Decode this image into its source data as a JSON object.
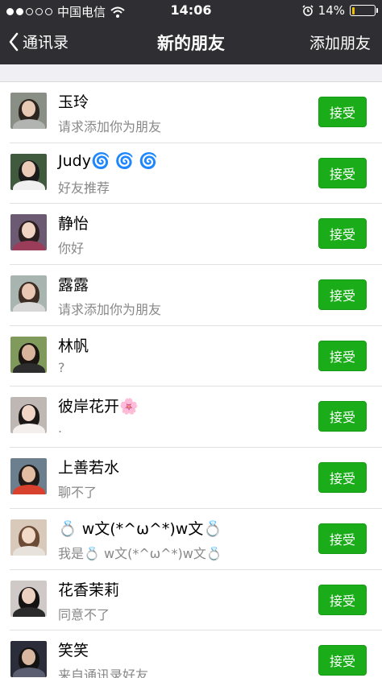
{
  "status_bar": {
    "carrier": "中国电信",
    "time": "14:06",
    "battery": "14%",
    "battery_level": 0.14,
    "signal_strength": 2,
    "signal_slots": 5,
    "battery_color": "#f2c200"
  },
  "nav": {
    "back_label": "通讯录",
    "title": "新的朋友",
    "right_action": "添加朋友"
  },
  "accent_color": "#1aad19",
  "requests": [
    {
      "name": "玉玲",
      "message": "请求添加你为朋友",
      "button": "接受",
      "avatar_bg": "#8a8f86",
      "avatar_hair": "#2b241f",
      "avatar_face": "#e8c9b4",
      "avatar_body": "#b1b4b0"
    },
    {
      "name": "Judy🌀 🌀 🌀",
      "message": "好友推荐",
      "button": "接受",
      "avatar_bg": "#3f5a3c",
      "avatar_hair": "#1b1b1b",
      "avatar_face": "#eacbb8",
      "avatar_body": "#f0f0f0"
    },
    {
      "name": "静怡",
      "message": "你好",
      "button": "接受",
      "avatar_bg": "#6b5a71",
      "avatar_hair": "#2a1e1e",
      "avatar_face": "#f0d3c3",
      "avatar_body": "#9a3d5b"
    },
    {
      "name": "露露",
      "message": "请求添加你为朋友",
      "button": "接受",
      "avatar_bg": "#a8b4b0",
      "avatar_hair": "#3c2c24",
      "avatar_face": "#e9c7b2",
      "avatar_body": "#d7d7d7"
    },
    {
      "name": "林帆",
      "message": "?",
      "button": "接受",
      "avatar_bg": "#7f9a5a",
      "avatar_hair": "#1b1612",
      "avatar_face": "#d9b49c",
      "avatar_body": "#2d2d2d"
    },
    {
      "name": "彼岸花开🌸",
      "message": ".",
      "button": "接受",
      "avatar_bg": "#bfb7b3",
      "avatar_hair": "#1d1818",
      "avatar_face": "#f1d5c6",
      "avatar_body": "#f2efed"
    },
    {
      "name": "上善若水",
      "message": "聊不了",
      "button": "接受",
      "avatar_bg": "#6b7f8f",
      "avatar_hair": "#1f1a17",
      "avatar_face": "#e2bca3",
      "avatar_body": "#d9412f"
    },
    {
      "name": "💍 w文(*^ω^*)w文💍",
      "message": "我是💍 w文(*^ω^*)w文💍",
      "button": "接受",
      "avatar_bg": "#d8c9bb",
      "avatar_hair": "#6b4b36",
      "avatar_face": "#f3d9c7",
      "avatar_body": "#e8e2dc"
    },
    {
      "name": "花香茉莉",
      "message": "同意不了",
      "button": "接受",
      "avatar_bg": "#cfcac7",
      "avatar_hair": "#151212",
      "avatar_face": "#ecd0c0",
      "avatar_body": "#2b2b2b"
    },
    {
      "name": "笑笑",
      "message": "来自通讯录好友",
      "button": "接受",
      "avatar_bg": "#2b2d3a",
      "avatar_hair": "#121212",
      "avatar_face": "#d8b7a1",
      "avatar_body": "#5a5e70"
    }
  ]
}
